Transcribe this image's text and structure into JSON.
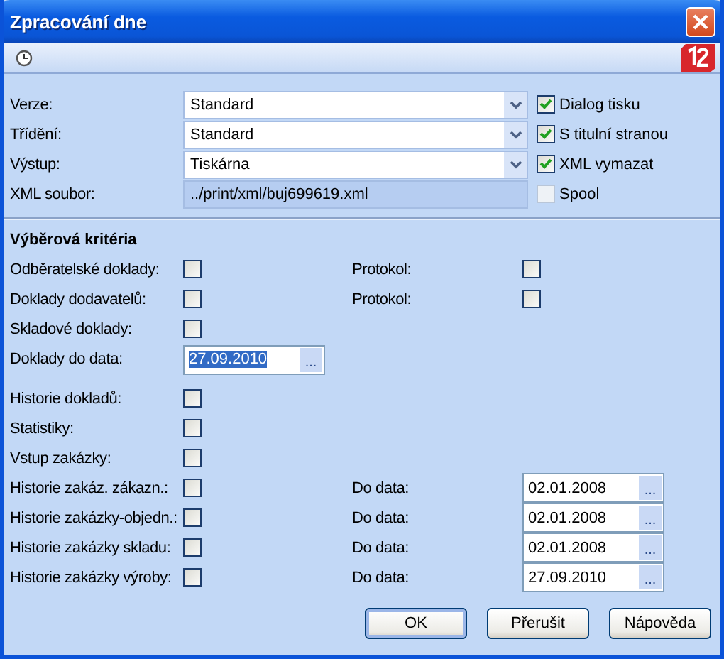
{
  "window": {
    "title": "Zpracování dne"
  },
  "top_fields": [
    {
      "label": "Verze:",
      "kind": "combo",
      "value": "Standard"
    },
    {
      "label": "Třídění:",
      "kind": "combo",
      "value": "Standard"
    },
    {
      "label": "Výstup:",
      "kind": "combo",
      "value": "Tiskárna"
    },
    {
      "label": "XML soubor:",
      "kind": "readonly",
      "value": "../print/xml/buj699619.xml"
    }
  ],
  "options": [
    {
      "label": "Dialog tisku",
      "checked": true,
      "disabled": false
    },
    {
      "label": "S titulní stranou",
      "checked": true,
      "disabled": false
    },
    {
      "label": "XML vymazat",
      "checked": true,
      "disabled": false
    },
    {
      "label": "Spool",
      "checked": false,
      "disabled": true
    }
  ],
  "section_title": "Výběrová kritéria",
  "criteria": [
    {
      "label": "Odběratelské doklady:",
      "kind": "check",
      "checked": false,
      "right": {
        "label": "Protokol:",
        "kind": "check",
        "checked": false
      }
    },
    {
      "label": "Doklady dodavatelů:",
      "kind": "check",
      "checked": false,
      "right": {
        "label": "Protokol:",
        "kind": "check",
        "checked": false
      }
    },
    {
      "label": "Skladové doklady:",
      "kind": "check",
      "checked": false
    },
    {
      "label": "Doklady do data:",
      "kind": "date",
      "value": "27.09.2010",
      "selected": true,
      "button": "..."
    },
    {
      "label": "Historie dokladů:",
      "kind": "check",
      "checked": false
    },
    {
      "label": "Statistiky:",
      "kind": "check",
      "checked": false
    },
    {
      "label": "Vstup zakázky:",
      "kind": "check",
      "checked": false
    },
    {
      "label": "Historie zakáz. zákazn.:",
      "kind": "check",
      "checked": false,
      "right": {
        "label": "Do data:",
        "kind": "date",
        "value": "02.01.2008",
        "selected": false,
        "button": "..."
      }
    },
    {
      "label": "Historie zakázky-objedn.:",
      "kind": "check",
      "checked": false,
      "right": {
        "label": "Do data:",
        "kind": "date",
        "value": "02.01.2008",
        "selected": false,
        "button": "..."
      }
    },
    {
      "label": "Historie zakázky skladu:",
      "kind": "check",
      "checked": false,
      "right": {
        "label": "Do data:",
        "kind": "date",
        "value": "02.01.2008",
        "selected": false,
        "button": "..."
      }
    },
    {
      "label": "Historie zakázky výroby:",
      "kind": "check",
      "checked": false,
      "right": {
        "label": "Do data:",
        "kind": "date",
        "value": "27.09.2010",
        "selected": false,
        "button": "..."
      }
    }
  ],
  "buttons": [
    {
      "label": "OK",
      "default": true
    },
    {
      "label": "Přerušit",
      "default": false
    },
    {
      "label": "Nápověda",
      "default": false
    }
  ]
}
